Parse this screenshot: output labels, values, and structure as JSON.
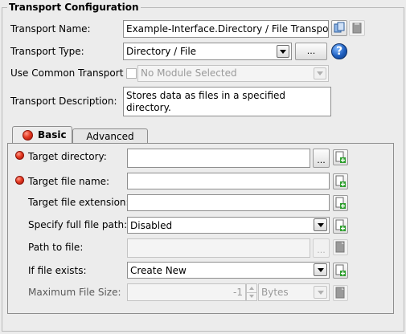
{
  "group_title": "Transport Configuration",
  "transport_name": {
    "label": "Transport Name:",
    "value": "Example-Interface.Directory / File Transport"
  },
  "transport_type": {
    "label": "Transport Type:",
    "value": "Directory / File",
    "browse_label": "..."
  },
  "use_common_transport": {
    "label": "Use Common Transport",
    "checked": false,
    "value": "No Module Selected"
  },
  "transport_description": {
    "label": "Transport Description:",
    "value": "Stores data as files in a specified directory."
  },
  "tabs": [
    {
      "label": "Basic",
      "active": true
    },
    {
      "label": "Advanced",
      "active": false
    }
  ],
  "basic": {
    "target_directory": {
      "label": "Target directory:",
      "value": "",
      "browse_label": "..."
    },
    "target_file_name": {
      "label": "Target file name:",
      "value": ""
    },
    "target_file_extension": {
      "label": "Target file extension:",
      "value": ""
    },
    "specify_full_file_path": {
      "label": "Specify full file path:",
      "value": "Disabled"
    },
    "path_to_file": {
      "label": "Path to file:",
      "value": "",
      "browse_label": "..."
    },
    "if_file_exists": {
      "label": "If file exists:",
      "value": "Create New"
    },
    "maximum_file_size": {
      "label": "Maximum File Size:",
      "value": "-1",
      "unit": "Bytes"
    }
  },
  "colors": {
    "error": "#e53b22",
    "help": "#1f5fbf",
    "add_icon": "#2e9e2e"
  }
}
